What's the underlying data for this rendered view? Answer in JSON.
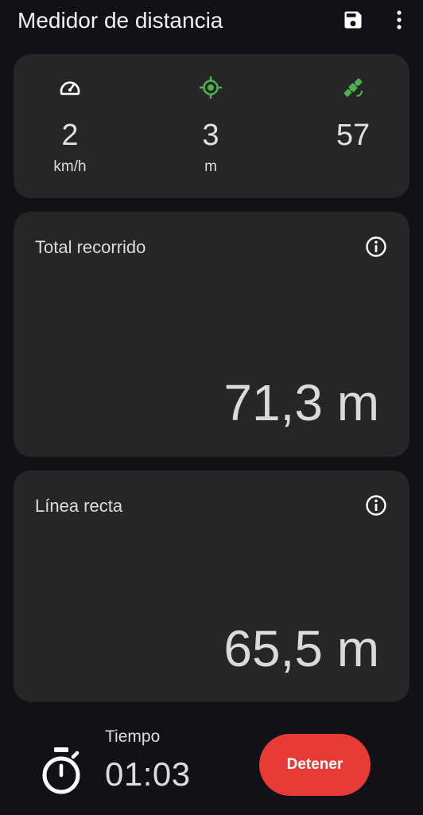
{
  "appbar": {
    "title": "Medidor de distancia",
    "save_icon": "save-icon",
    "more_icon": "more-vert-icon"
  },
  "stats": {
    "speed": {
      "icon": "speedometer-icon",
      "value": "2",
      "unit": "km/h",
      "icon_color": "#ffffff"
    },
    "accuracy": {
      "icon": "gps-fixed-icon",
      "value": "3",
      "unit": "m",
      "icon_color": "#4caf50"
    },
    "satellites": {
      "icon": "satellite-icon",
      "value": "57",
      "icon_color": "#4caf50"
    }
  },
  "total": {
    "label": "Total recorrido",
    "value": "71,3 m",
    "info_icon": "info-icon"
  },
  "straight": {
    "label": "Línea recta",
    "value": "65,5 m",
    "info_icon": "info-icon"
  },
  "timer": {
    "icon": "stopwatch-icon",
    "label": "Tiempo",
    "value": "01:03"
  },
  "actions": {
    "stop_label": "Detener",
    "stop_color": "#e83b37"
  },
  "colors": {
    "background": "#121117",
    "card": "#262626",
    "accent_green": "#4caf50"
  }
}
